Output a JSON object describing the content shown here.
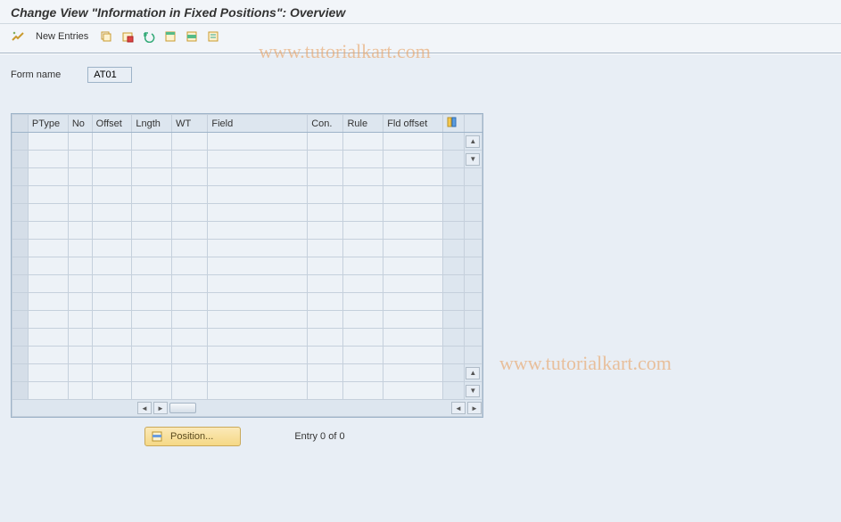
{
  "title": "Change View \"Information in Fixed Positions\": Overview",
  "toolbar": {
    "new_entries": "New Entries"
  },
  "form": {
    "name_label": "Form name",
    "name_value": "AT01"
  },
  "table": {
    "headers": {
      "ptype": "PType",
      "no": "No",
      "offset": "Offset",
      "lngth": "Lngth",
      "wt": "WT",
      "field": "Field",
      "con": "Con.",
      "rule": "Rule",
      "fld_offset": "Fld offset"
    }
  },
  "footer": {
    "position_label": "Position...",
    "entry_text": "Entry 0 of 0"
  },
  "watermark": "www.tutorialkart.com"
}
